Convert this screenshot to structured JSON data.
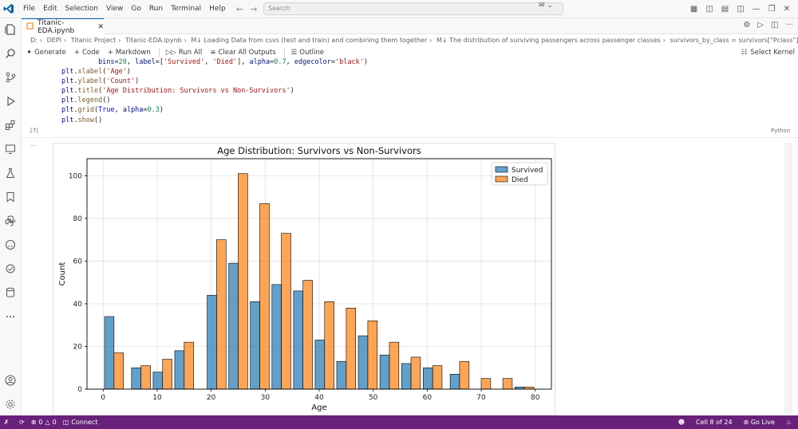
{
  "menu": [
    "File",
    "Edit",
    "Selection",
    "View",
    "Go",
    "Run",
    "Terminal",
    "Help"
  ],
  "search": {
    "placeholder": "Search"
  },
  "tab": {
    "title": "Titanic-EDA.ipynb"
  },
  "breadcrumb": [
    "D:",
    "DEPI",
    "Titanic Project",
    "Titanic-EDA.ipynb",
    "M↓ Loading Data from csvs (test and train) and combining them together",
    "M↓ The distribution of surviving passengers across passenger classes",
    "survivors_by_class = survivors[\"Pclass\"].value_counts().sort_inde"
  ],
  "toolbar": {
    "generate": "Generate",
    "code": "Code",
    "markdown": "Markdown",
    "run_all": "Run All",
    "clear_outputs": "Clear All Outputs",
    "outline": "Outline",
    "kernel": "Select Kernel"
  },
  "code_lines": [
    "         bins=20, label=['Survived', 'Died'], alpha=0.7, edgecolor='black')",
    "plt.xlabel('Age')",
    "plt.ylabel('Count')",
    "plt.title('Age Distribution: Survivors vs Non-Survivors')",
    "plt.legend()",
    "plt.grid(True, alpha=0.3)",
    "plt.show()"
  ],
  "cell": {
    "exec_count": "[7]",
    "language": "Python",
    "output_marker": "..."
  },
  "status": {
    "errors": "0",
    "warnings": "0",
    "connect": "Connect",
    "cell_position": "Cell 8 of 24",
    "go_live": "Go Live"
  },
  "colors": {
    "survived": "#1f77b4",
    "died": "#ff7f0e",
    "statusbar": "#68217a",
    "accent": "#005fb8"
  },
  "chart_data": {
    "type": "bar",
    "title": "Age Distribution: Survivors vs Non-Survivors",
    "xlabel": "Age",
    "ylabel": "Count",
    "xlim": [
      -3,
      83
    ],
    "ylim": [
      0,
      108
    ],
    "xticks": [
      0,
      10,
      20,
      30,
      40,
      50,
      60,
      70,
      80
    ],
    "yticks": [
      0,
      20,
      40,
      60,
      80,
      100
    ],
    "grid": true,
    "legend_position": "top-right",
    "bin_centers": [
      2,
      7,
      11,
      15,
      21,
      25,
      29,
      33,
      37,
      41,
      45,
      49,
      53,
      57,
      61,
      66,
      70,
      74,
      78
    ],
    "series": [
      {
        "name": "Survived",
        "values": [
          34,
          10,
          8,
          18,
          44,
          59,
          41,
          49,
          46,
          23,
          13,
          25,
          16,
          12,
          10,
          7,
          0,
          0,
          1,
          1
        ]
      },
      {
        "name": "Died",
        "values": [
          17,
          11,
          14,
          22,
          70,
          101,
          87,
          73,
          51,
          41,
          38,
          32,
          22,
          15,
          11,
          13,
          5,
          5,
          1,
          0
        ]
      }
    ]
  }
}
